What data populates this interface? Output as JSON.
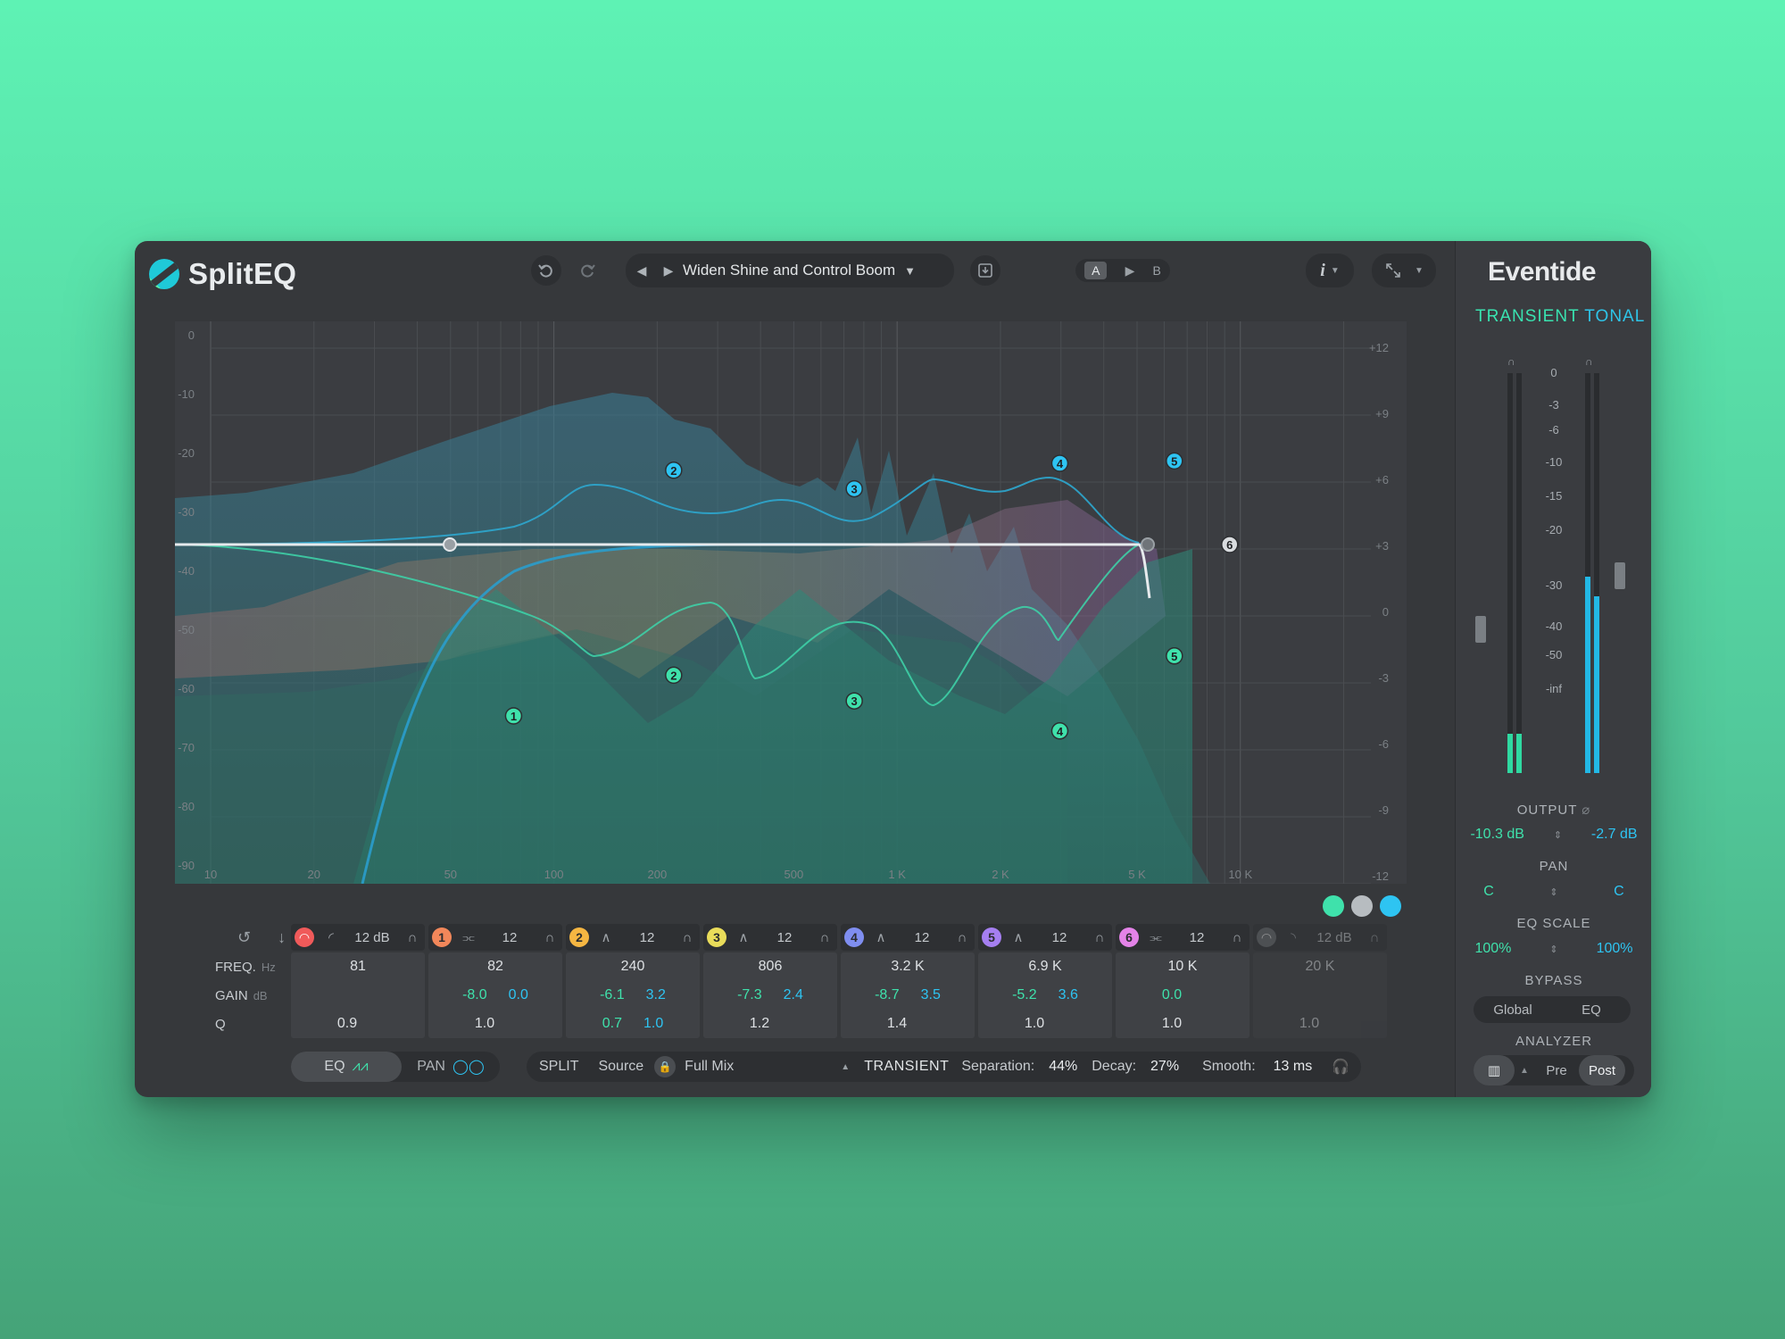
{
  "app": {
    "name": "SplitEQ",
    "brand": "Eventide"
  },
  "header": {
    "preset_name": "Widen Shine and Control Boom",
    "ab": {
      "a": "A",
      "b": "B"
    },
    "info": "i"
  },
  "modes": {
    "transient": "TRANSIENT",
    "tonal": "TONAL"
  },
  "graph": {
    "left_scale": [
      "0",
      "-10",
      "-20",
      "-30",
      "-40",
      "-50",
      "-60",
      "-70",
      "-80",
      "-90"
    ],
    "right_scale": [
      "+12",
      "+9",
      "+6",
      "+3",
      "0",
      "-3",
      "-6",
      "-9",
      "-12"
    ],
    "freq_labels": [
      "10",
      "20",
      "50",
      "100",
      "200",
      "500",
      "1 K",
      "2 K",
      "5 K",
      "10 K"
    ],
    "nodes": [
      {
        "id": "1",
        "freq_hz": 82,
        "gain_db": -8.0,
        "layer": "transient"
      },
      {
        "id": "2",
        "freq_hz": 240,
        "gain_db": 3.2,
        "layer": "tonal"
      },
      {
        "id": "2",
        "freq_hz": 240,
        "gain_db": -6.1,
        "layer": "transient"
      },
      {
        "id": "3",
        "freq_hz": 806,
        "gain_db": 2.4,
        "layer": "tonal"
      },
      {
        "id": "3",
        "freq_hz": 806,
        "gain_db": -7.3,
        "layer": "transient"
      },
      {
        "id": "4",
        "freq_hz": 3200,
        "gain_db": 3.5,
        "layer": "tonal"
      },
      {
        "id": "4",
        "freq_hz": 3200,
        "gain_db": -8.7,
        "layer": "transient"
      },
      {
        "id": "5",
        "freq_hz": 6900,
        "gain_db": 3.6,
        "layer": "tonal"
      },
      {
        "id": "5",
        "freq_hz": 6900,
        "gain_db": -5.2,
        "layer": "transient"
      },
      {
        "id": "6",
        "freq_hz": 10000,
        "gain_db": 0.0,
        "layer": "shared"
      }
    ]
  },
  "bands": {
    "row_labels": {
      "freq": "FREQ.",
      "freq_unit": "Hz",
      "gain": "GAIN",
      "gain_unit": "dB",
      "q": "Q"
    },
    "items": [
      {
        "num": "",
        "color": "#f05a5a",
        "slope": "12 dB",
        "freq": "81",
        "gain_t": "",
        "gain_s": "",
        "q_t": "0.9",
        "q_s": "",
        "enabled": true
      },
      {
        "num": "1",
        "color": "#f2875a",
        "slope": "12",
        "freq": "82",
        "gain_t": "-8.0",
        "gain_s": "0.0",
        "q_t": "1.0",
        "q_s": "",
        "enabled": true
      },
      {
        "num": "2",
        "color": "#f5b642",
        "slope": "12",
        "freq": "240",
        "gain_t": "-6.1",
        "gain_s": "3.2",
        "q_t": "0.7",
        "q_s": "1.0",
        "enabled": true
      },
      {
        "num": "3",
        "color": "#e9dc5a",
        "slope": "12",
        "freq": "806",
        "gain_t": "-7.3",
        "gain_s": "2.4",
        "q_t": "1.2",
        "q_s": "",
        "enabled": true
      },
      {
        "num": "4",
        "color": "#7f8ef0",
        "slope": "12",
        "freq": "3.2 K",
        "gain_t": "-8.7",
        "gain_s": "3.5",
        "q_t": "1.4",
        "q_s": "",
        "enabled": true
      },
      {
        "num": "5",
        "color": "#a57ff0",
        "slope": "12",
        "freq": "6.9 K",
        "gain_t": "-5.2",
        "gain_s": "3.6",
        "q_t": "1.0",
        "q_s": "",
        "enabled": true
      },
      {
        "num": "6",
        "color": "#e483e8",
        "slope": "12",
        "freq": "10 K",
        "gain_t": "0.0",
        "gain_s": "",
        "q_t": "1.0",
        "q_s": "",
        "enabled": true
      },
      {
        "num": "",
        "color": "#6a6d71",
        "slope": "12 dB",
        "freq": "20 K",
        "gain_t": "",
        "gain_s": "",
        "q_t": "1.0",
        "q_s": "",
        "enabled": false
      }
    ]
  },
  "bottom": {
    "eq_label": "EQ",
    "pan_label": "PAN",
    "split_label": "SPLIT",
    "source_label": "Source",
    "source_value": "Full Mix",
    "transient_label": "TRANSIENT",
    "separation_label": "Separation:",
    "separation_value": "44%",
    "decay_label": "Decay:",
    "decay_value": "27%",
    "smooth_label": "Smooth:",
    "smooth_value": "13 ms"
  },
  "side": {
    "meter_scale": [
      "0",
      "-3",
      "-6",
      "-10",
      "-15",
      "-20",
      "-30",
      "-40",
      "-50",
      "-inf"
    ],
    "meters": {
      "transient_level": 0.1,
      "tonal_level": 0.5
    },
    "output_label": "OUTPUT",
    "output_transient": "-10.3 dB",
    "output_tonal": "-2.7 dB",
    "pan_label": "PAN",
    "pan_transient": "C",
    "pan_tonal": "C",
    "eq_scale_label": "EQ SCALE",
    "eq_scale_transient": "100%",
    "eq_scale_tonal": "100%",
    "bypass_label": "BYPASS",
    "bypass_global": "Global",
    "bypass_eq": "EQ",
    "analyzer_label": "ANALYZER",
    "analyzer_pre": "Pre",
    "analyzer_post": "Post"
  },
  "colors": {
    "transient": "#3fe1ab",
    "tonal": "#2ec4f2",
    "panel": "#36383b"
  }
}
